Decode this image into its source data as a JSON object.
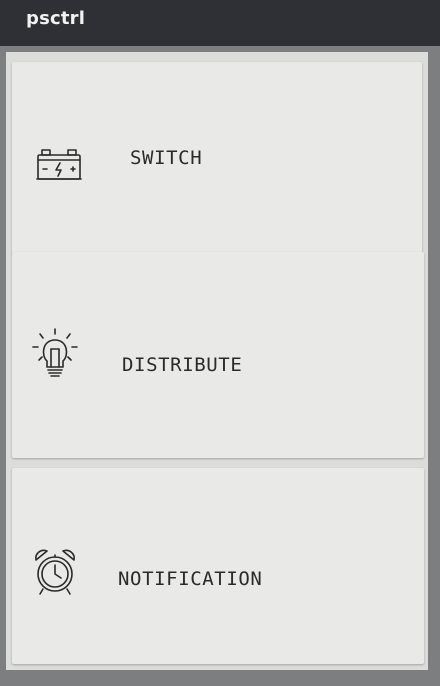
{
  "app_bar": {
    "title": "psctrl"
  },
  "menu": {
    "items": [
      {
        "label": "SWITCH",
        "icon": "battery-icon"
      },
      {
        "label": "DISTRIBUTE",
        "icon": "lightbulb-icon"
      },
      {
        "label": "NOTIFICATION",
        "icon": "alarm-clock-icon"
      }
    ]
  },
  "colors": {
    "app_bar_bg": "#2f3035",
    "card_bg": "#e9e9e7",
    "text": "#2a2a2a"
  }
}
